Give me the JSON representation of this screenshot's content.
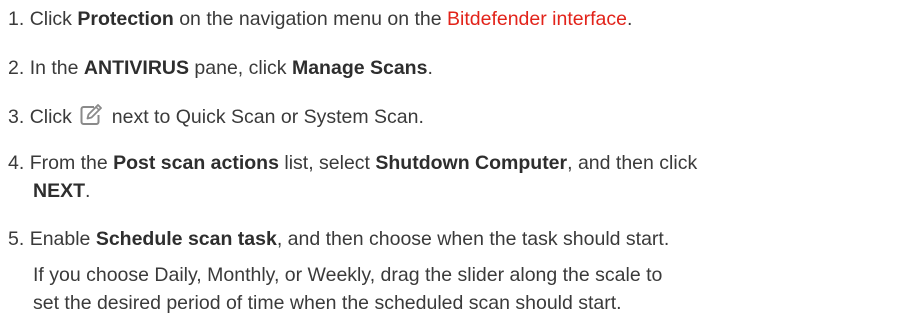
{
  "steps": [
    {
      "num": "1.",
      "t1": "Click ",
      "b1": "Protection",
      "t2": " on the navigation menu on the ",
      "link": "Bitdefender interface",
      "t3": "."
    },
    {
      "num": "2.",
      "t1": "In the ",
      "b1": "ANTIVIRUS",
      "t2": " pane, click ",
      "b2": "Manage Scans",
      "t3": "."
    },
    {
      "num": "3.",
      "t1": "Click ",
      "icon": "edit-icon",
      "t2": " next to Quick Scan or System Scan."
    },
    {
      "num": "4.",
      "t1": "From the ",
      "b1": "Post scan actions",
      "t2": " list, select ",
      "b2": "Shutdown Computer",
      "t3": ", and then click",
      "b3": "NEXT",
      "t4": "."
    },
    {
      "num": "5.",
      "t1": "Enable ",
      "b1": "Schedule scan task",
      "t2": ", and then choose when the task should start."
    }
  ],
  "note": {
    "line1": "If you choose Daily, Monthly, or Weekly, drag the slider along the scale to",
    "line2": "set the desired period of time when the scheduled scan should start."
  },
  "colors": {
    "text": "#3a3a3a",
    "link": "#e2231a",
    "icon": "#8a8a8a"
  }
}
